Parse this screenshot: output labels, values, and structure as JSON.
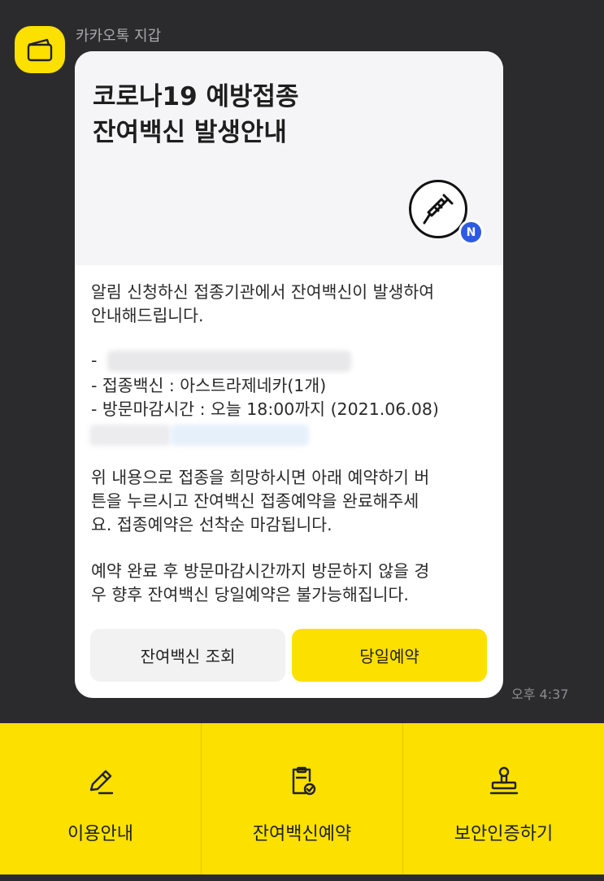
{
  "chat": {
    "sender": "카카오톡 지갑",
    "time": "오후 4:37"
  },
  "card": {
    "title_line1": "코로나19 예방접종",
    "title_line2": "잔여백신 발생안내",
    "badge_letter": "N",
    "intro_line1": "알림 신청하신 접종기관에서 잔여백신이 발생하여",
    "intro_line2": "안내해드립니다.",
    "detail_dash": "-",
    "detail_vaccine": "- 접종백신 : 아스트라제네카(1개)",
    "detail_deadline": "- 방문마감시간 : 오늘 18:00까지 (2021.06.08)",
    "para2_line1": "위 내용으로 접종을 희망하시면 아래 예약하기 버",
    "para2_line2": "튼을 누르시고 잔여백신 접종예약을 완료해주세",
    "para2_line3": "요. 접종예약은 선착순 마감됩니다.",
    "para3_line1": "예약 완료 후 방문마감시간까지 방문하지 않을 경",
    "para3_line2": "우 향후  잔여백신 당일예약은 불가능해집니다.",
    "button_check": "잔여백신 조회",
    "button_reserve": "당일예약"
  },
  "bottom_menu": [
    {
      "label": "이용안내",
      "icon": "pencil-icon"
    },
    {
      "label": "잔여백신예약",
      "icon": "clipboard-check-icon"
    },
    {
      "label": "보안인증하기",
      "icon": "stamp-icon"
    }
  ],
  "colors": {
    "background": "#2b2b2d",
    "accent_yellow": "#fbe000",
    "badge_blue": "#2d5be3"
  }
}
